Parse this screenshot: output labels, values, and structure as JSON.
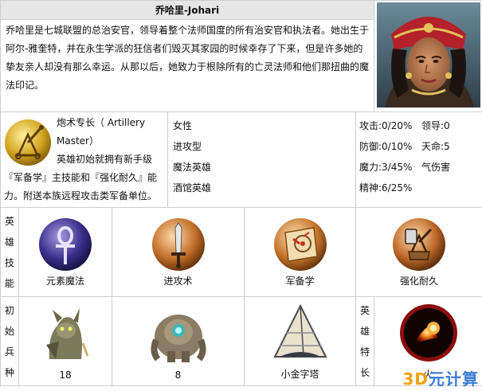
{
  "hero": {
    "name": "乔哈里-Johari",
    "bio": "乔哈里是七城联盟的总治安官，领导着整个法师国度的所有治安官和执法者。她出生于阿尔-雅奎特，并在永生学派的狂信者们毁灭其家园的时候幸存了下来，但是许多她的挚友亲人却没有那么幸运。从那以后，她致力于根除所有的亡灵法师和他们那扭曲的魔法印记。"
  },
  "specialty": {
    "title": "炮术专长（ Artillery Master）",
    "description": "英雄初始就拥有新手级『军备学』主技能和『强化耐久』能力。附送本族远程攻击类军备单位。",
    "icon": "catapult-icon"
  },
  "attributes": {
    "gender": "女性",
    "style": "进攻型",
    "class": "魔法英雄",
    "tavern": "酒馆英雄"
  },
  "stats": {
    "attack": "攻击:0/20%",
    "leadership": "领导:0",
    "defense": "防御:0/10%",
    "destiny": "天命:5",
    "magic": "魔力:3/45%",
    "qi": "气伤害",
    "spirit": "精神:6/25%"
  },
  "skills": {
    "label": "英雄技能",
    "items": [
      {
        "label": "元素魔法",
        "icon": "ankh-icon"
      },
      {
        "label": "进攻术",
        "icon": "sword-icon"
      },
      {
        "label": "军备学",
        "icon": "war-machines-icon"
      },
      {
        "label": "强化耐久",
        "icon": "catapult-icon"
      }
    ]
  },
  "troops": {
    "label": "初始兵种",
    "items": [
      {
        "count": "18",
        "icon": "gremlin-icon"
      },
      {
        "count": "8",
        "icon": "golem-icon"
      },
      {
        "name": "小金字塔",
        "icon": "pyramid-icon"
      }
    ]
  },
  "hero_special": {
    "label": "英雄特长",
    "name": "火",
    "icon": "fireball-icon"
  },
  "watermark": {
    "prefix": "3D",
    "text": "元计算"
  },
  "colors": {
    "header_bg": "#e6e6e6",
    "border": "#cfcfcf",
    "gold": "#c9a227"
  }
}
